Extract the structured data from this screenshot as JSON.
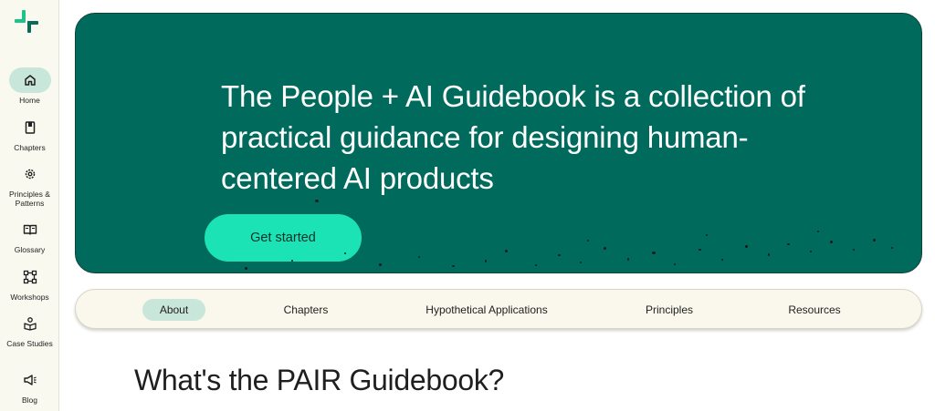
{
  "sidebar": {
    "items": [
      {
        "label": "Home",
        "icon": "home-icon",
        "active": true
      },
      {
        "label": "Chapters",
        "icon": "book-icon",
        "active": false
      },
      {
        "label": "Principles & Patterns",
        "icon": "gear-icon",
        "active": false
      },
      {
        "label": "Glossary",
        "icon": "open-book-icon",
        "active": false
      },
      {
        "label": "Workshops",
        "icon": "nodes-icon",
        "active": false
      },
      {
        "label": "Case Studies",
        "icon": "reader-icon",
        "active": false
      },
      {
        "label": "Blog",
        "icon": "megaphone-icon",
        "active": false
      }
    ]
  },
  "hero": {
    "title": "The People + AI Guidebook is a collection of practical guidance for designing human-centered AI products",
    "cta_label": "Get started"
  },
  "tabs": [
    {
      "label": "About",
      "active": true
    },
    {
      "label": "Chapters",
      "active": false
    },
    {
      "label": "Hypothetical Applications",
      "active": false
    },
    {
      "label": "Principles",
      "active": false
    },
    {
      "label": "Resources",
      "active": false
    }
  ],
  "main": {
    "section_title": "What's the PAIR Guidebook?"
  },
  "colors": {
    "hero_bg": "#006b5c",
    "accent": "#1ce3b6",
    "active_pill": "#c8e6d9",
    "sidebar_bg": "#faf9f0"
  }
}
